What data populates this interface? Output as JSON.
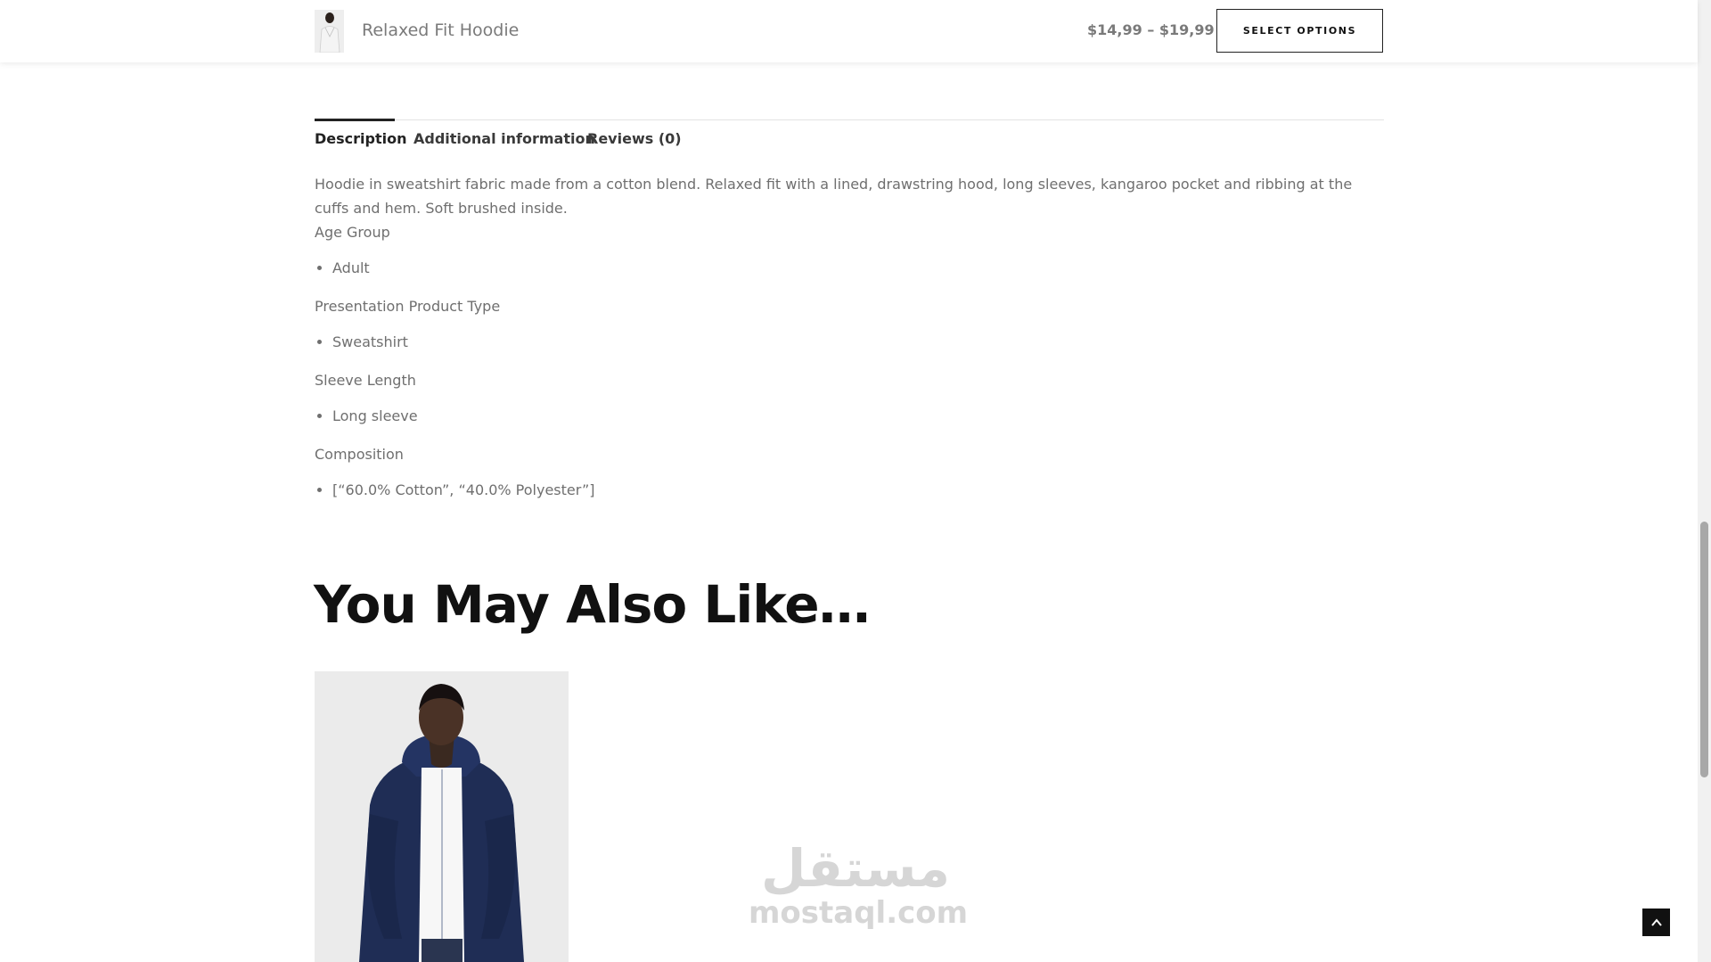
{
  "sticky_bar": {
    "product_title": "Relaxed Fit Hoodie",
    "price_range": "$14,99 – $19,99",
    "select_options_label": "SELECT OPTIONS"
  },
  "tabs": [
    {
      "label": "Description"
    },
    {
      "label": "Additional information"
    },
    {
      "label": "Reviews (0)"
    }
  ],
  "description": {
    "text": "Hoodie in sweatshirt fabric made from a cotton blend. Relaxed fit with a lined, drawstring hood, long sleeves, kangaroo pocket and ribbing at the cuffs and hem. Soft brushed inside.",
    "attributes": [
      {
        "label": "Age Group",
        "value": "Adult"
      },
      {
        "label": "Presentation Product Type",
        "value": "Sweatshirt"
      },
      {
        "label": "Sleeve Length",
        "value": "Long sleeve"
      },
      {
        "label": "Composition",
        "value": "[“60.0% Cotton”, “40.0% Polyester”]"
      }
    ]
  },
  "related": {
    "heading": "You May Also Like…"
  },
  "watermark": {
    "arabic": "مستقل",
    "latin": "mostaql.com"
  },
  "icons": {
    "back_to_top": "chevron-up-icon"
  }
}
